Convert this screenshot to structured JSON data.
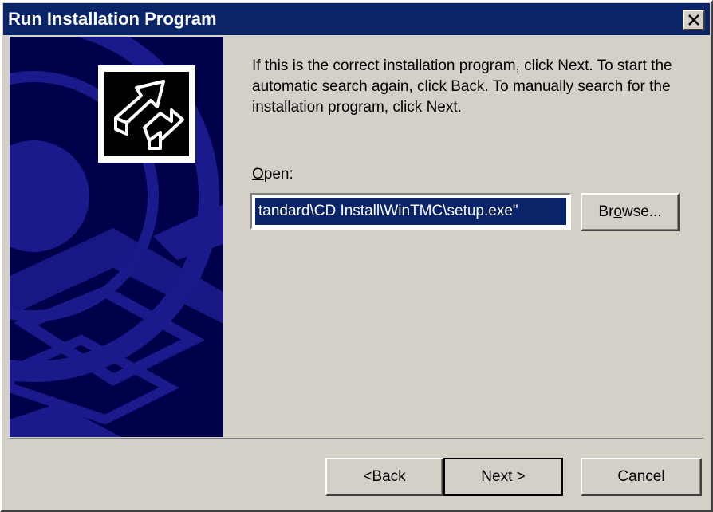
{
  "window": {
    "title": "Run Installation Program"
  },
  "content": {
    "instructions": "If this is the correct installation program, click Next. To start the automatic search again, click Back. To manually search for the installation program, click Next.",
    "open_label_mnemonic": "O",
    "open_label_rest": "pen:",
    "path_value": "tandard\\CD Install\\WinTMC\\setup.exe\""
  },
  "buttons": {
    "browse_pre": "Br",
    "browse_mn": "o",
    "browse_post": "wse...",
    "back_pre": "< ",
    "back_mn": "B",
    "back_post": "ack",
    "next_mn": "N",
    "next_post": "ext >",
    "cancel": "Cancel"
  },
  "colors": {
    "titlebar": "#0a246a",
    "banner": "#00004a",
    "face": "#d4d0c8"
  },
  "icons": {
    "close": "close-icon",
    "setup": "setup-arrow-icon"
  }
}
